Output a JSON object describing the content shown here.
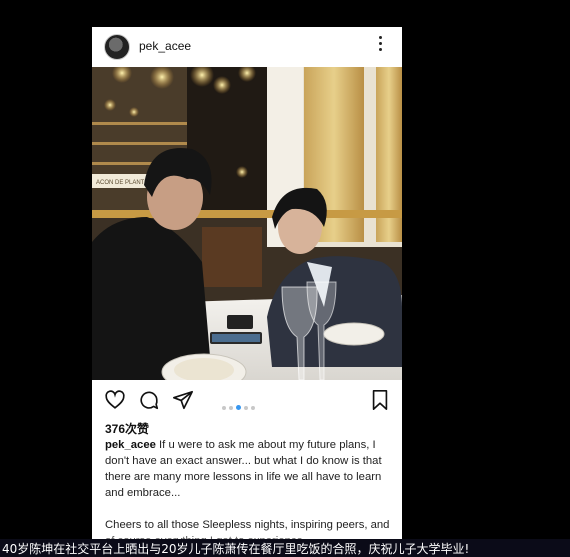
{
  "post": {
    "username": "pek_acee",
    "likes": "376次赞",
    "caption_user": "pek_acee",
    "caption_text": " If u were to ask me about my future plans, I don't have an exact answer... but what I do know is that there are many more lessons in life we all have to learn and embrace...",
    "caption_more": "Cheers to all those Sleepless nights, inspiring peers, and of course everything I get to experience",
    "carousel": {
      "count": 5,
      "active": 1
    },
    "photo_sign": "ACON DE PLANTS"
  },
  "icons": {
    "more": "more-vertical-icon",
    "like": "heart-icon",
    "comment": "comment-icon",
    "share": "send-icon",
    "save": "bookmark-icon"
  },
  "subtitle": {
    "text": "40岁陈坤在社交平台上晒出与20岁儿子陈萧传在餐厅里吃饭的合照，庆祝儿子大学毕业!"
  },
  "colors": {
    "active_dot": "#3797f0",
    "background": "#000000"
  }
}
